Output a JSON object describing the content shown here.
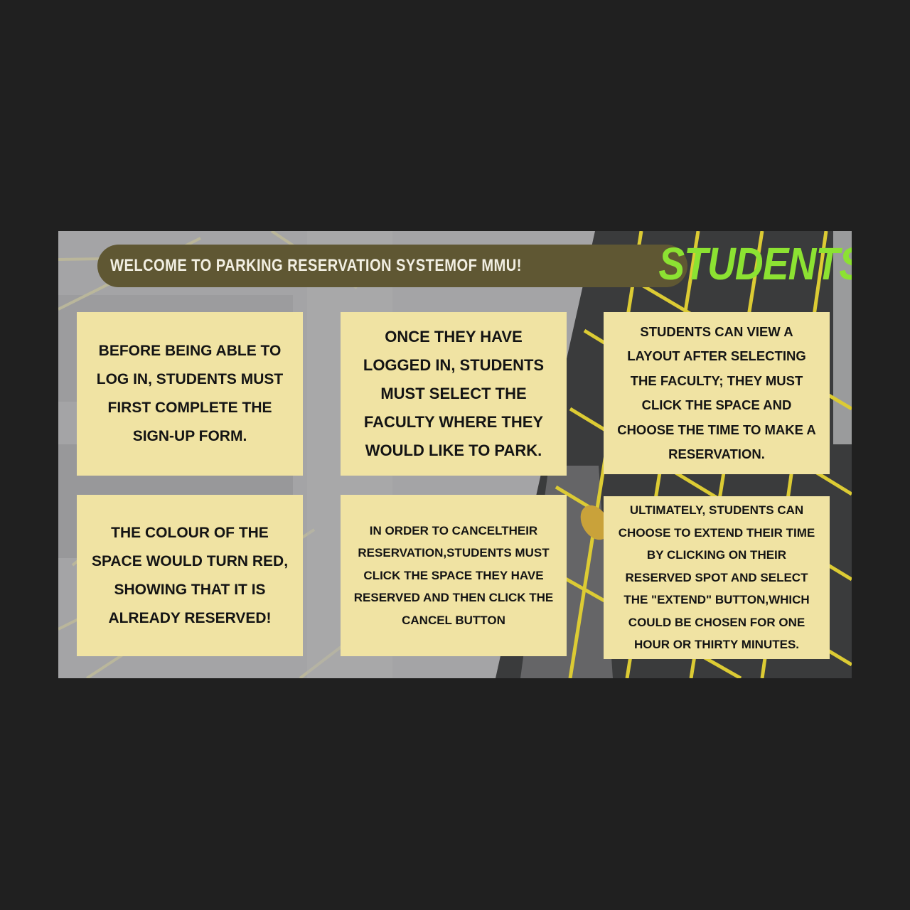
{
  "header": {
    "welcome_text": "WELCOME TO PARKING RESERVATION SYSTEMOF MMU!",
    "title": "STUDENTS"
  },
  "cards": [
    {
      "text": "BEFORE BEING ABLE TO LOG IN, STUDENTS MUST FIRST COMPLETE THE SIGN-UP FORM."
    },
    {
      "text": "ONCE THEY HAVE LOGGED IN, STUDENTS MUST SELECT THE FACULTY WHERE THEY WOULD LIKE TO PARK."
    },
    {
      "text": "STUDENTS CAN VIEW A LAYOUT AFTER SELECTING THE FACULTY; THEY MUST CLICK THE SPACE AND CHOOSE THE TIME TO MAKE A RESERVATION."
    },
    {
      "text": "THE COLOUR OF THE SPACE WOULD TURN RED, SHOWING THAT IT IS ALREADY RESERVED!"
    },
    {
      "text": "IN ORDER TO CANCELTHEIR RESERVATION,STUDENTS MUST CLICK THE SPACE THEY HAVE RESERVED AND THEN CLICK THE CANCEL BUTTON"
    },
    {
      "text": "ULTIMATELY, STUDENTS CAN CHOOSE TO EXTEND THEIR TIME BY CLICKING ON THEIR RESERVED SPOT AND SELECT THE \"EXTEND\" BUTTON,WHICH COULD BE CHOSEN FOR ONE HOUR OR THIRTY MINUTES."
    }
  ],
  "colors": {
    "page_background": "#202020",
    "banner": "#5f5733",
    "title_green": "#8ce232",
    "card": "#f0e3a3",
    "parking_line_yellow": "#e2d23c"
  }
}
